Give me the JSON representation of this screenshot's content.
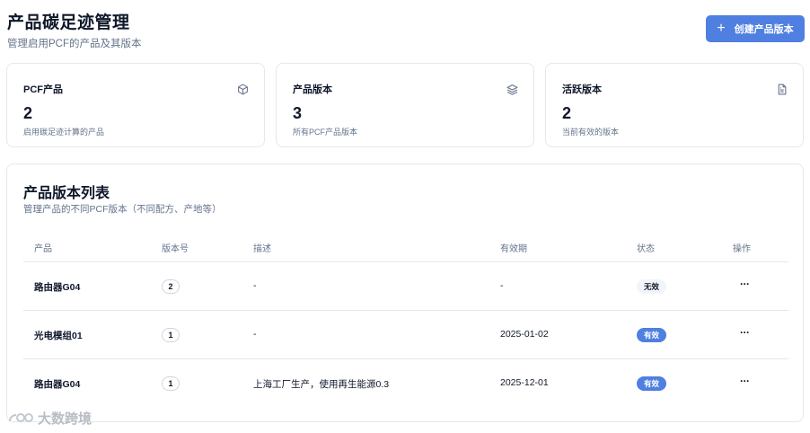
{
  "header": {
    "title": "产品碳足迹管理",
    "subtitle": "管理启用PCF的产品及其版本",
    "create_button": "创建产品版本",
    "create_icon": "plus-icon"
  },
  "stats": [
    {
      "title": "PCF产品",
      "value": "2",
      "desc": "启用碳足迹计算的产品",
      "icon": "box-icon"
    },
    {
      "title": "产品版本",
      "value": "3",
      "desc": "所有PCF产品版本",
      "icon": "layers-icon"
    },
    {
      "title": "活跃版本",
      "value": "2",
      "desc": "当前有效的版本",
      "icon": "file-text-icon"
    }
  ],
  "list": {
    "title": "产品版本列表",
    "subtitle": "管理产品的不同PCF版本（不同配方、产地等）",
    "columns": [
      "产品",
      "版本号",
      "描述",
      "有效期",
      "状态",
      "操作"
    ],
    "rows": [
      {
        "product": "路由器G04",
        "version": "2",
        "description": "-",
        "valid_until": "-",
        "status": "无效",
        "action": "···"
      },
      {
        "product": "光电模组01",
        "version": "1",
        "description": "-",
        "valid_until": "2025-01-02",
        "status": "有效",
        "action": "···"
      },
      {
        "product": "路由器G04",
        "version": "1",
        "description": "上海工厂生产，使用再生能源0.3",
        "valid_until": "2025-12-01",
        "status": "有效",
        "action": "···"
      }
    ]
  },
  "colors": {
    "primary": "#4f7fe0",
    "muted_text": "#64748b",
    "border": "#e5e7eb"
  },
  "watermark": {
    "text": "大数跨境"
  }
}
